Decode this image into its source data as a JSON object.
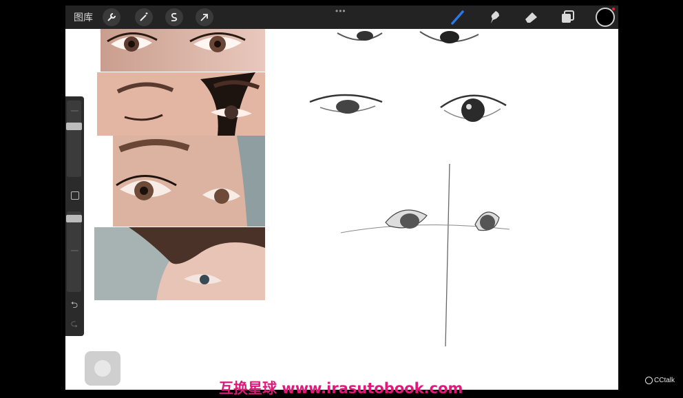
{
  "topbar": {
    "gallery_label": "图库",
    "left_tools": [
      "wrench-icon",
      "magic-wand-icon",
      "selection-s-icon",
      "move-arrow-icon"
    ],
    "dots_label": "•••",
    "right_tools": [
      "brush-icon",
      "smudge-icon",
      "eraser-icon",
      "layers-icon"
    ],
    "current_color": "#000000",
    "accent_color": "#2a79e8"
  },
  "sidebar": {
    "undo_label": "⮌",
    "redo_label": "⮎",
    "brush_size_level": 0.85,
    "opacity_level": 0.95
  },
  "watermark": {
    "text": "互换星球 www.irasutobook.com",
    "color": "#e0187a"
  },
  "cctalk": {
    "label": "CCtalk"
  }
}
